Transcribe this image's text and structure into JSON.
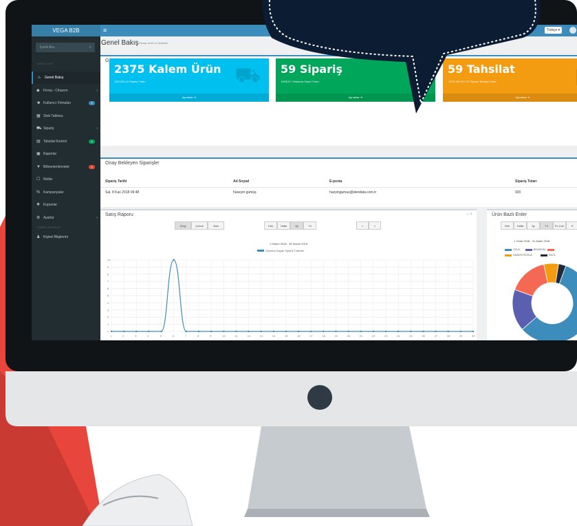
{
  "app": {
    "brand": "VEGA B2B",
    "menu_icon": "hamburger-icon",
    "language": "Türkçe ▾"
  },
  "sidebar": {
    "search_placeholder": "İçerik Ara...",
    "section_label": "MENÜLER",
    "items": [
      {
        "icon": "home-icon",
        "label": "Genel Bakış",
        "active": true
      },
      {
        "icon": "tags-icon",
        "label": "Firma - Cihazım",
        "chevron": true
      },
      {
        "icon": "users-icon",
        "label": "Kullanıcı Firmaları",
        "badge": "1",
        "badge_color": "#3c8dbc"
      },
      {
        "icon": "table-icon",
        "label": "Stok Tablosu"
      },
      {
        "icon": "cart-icon",
        "label": "Sipariş",
        "chevron": true
      },
      {
        "icon": "money-icon",
        "label": "Tahsilat Kontrol",
        "badge": "1",
        "badge_color": "#00a65a"
      },
      {
        "icon": "report-icon",
        "label": "Raporlar"
      },
      {
        "icon": "filter-icon",
        "label": "Bilinenlerlimneler",
        "badge": "1",
        "badge_color": "#dd4b39"
      },
      {
        "icon": "note-icon",
        "label": "Notlar"
      },
      {
        "icon": "percent-icon",
        "label": "Kampanyalar"
      },
      {
        "icon": "coupon-icon",
        "label": "Kuponlar"
      },
      {
        "icon": "settings-icon",
        "label": "Ayarlar",
        "chevron": true
      }
    ],
    "section2_label": "KİŞİSEL BİLGİLER",
    "items2": [
      {
        "icon": "user-icon",
        "label": "Kişisel Bilgilerim"
      }
    ]
  },
  "header": {
    "title": "Genel Bakış",
    "subtitle": "Hesap özeti ve istatistik"
  },
  "summary": {
    "title": "Genel",
    "tiles": [
      {
        "big": "2375 Kalem Ürün",
        "small": "625.002,24 Sipariş Tutarı",
        "foot": "Ayrıntılar ➜",
        "color": "#00c0ef",
        "glyph": "cart-icon"
      },
      {
        "big": "59 Sipariş",
        "small": "6308,07 Ortalama Sepet Tutarı",
        "foot": "Ayrıntılar ➜",
        "color": "#00a65a",
        "glyph": "bar-chart-icon"
      },
      {
        "big": "59 Tahsilat",
        "small": "4130.398,007,24 Toplam Tahsilat Tutarı",
        "foot": "Ayrıntılar ➜",
        "color": "#f39c12",
        "glyph": "money-icon"
      }
    ]
  },
  "pending": {
    "title": "Onay Bekleyen Siparişler",
    "columns": [
      "Sipariş Tarihi",
      "Ad Soyad",
      "E-posta",
      "Sipariş Tutarı"
    ],
    "rows": [
      [
        "Sal, 8 Kas 2018 09:48",
        "hüseyin gümüş",
        "hueyingumus@deridata.com.tr",
        "920"
      ]
    ]
  },
  "sales": {
    "title": "Satış Raporu",
    "group1": [
      "Çizgi",
      "Çubuk",
      "Alan"
    ],
    "group1_active": 0,
    "group2": [
      "Gün",
      "Hafta",
      "Ay",
      "Yıl"
    ],
    "group2_active": 2,
    "group3": [
      "«",
      "»"
    ],
    "window_controls": "–  ×",
    "range": "1 Kasım 2018 - 30 Kasım 2018",
    "legend": "Zamana Dayalı Sipariş Tutarları"
  },
  "products": {
    "title": "Ürün Bazlı Enler",
    "buttons": [
      "Gün",
      "Hafta",
      "Ay",
      "Yıl",
      "En Çok",
      "E"
    ],
    "active": 3,
    "range": "1 Ocak 2018 - 31 Aralık 2018",
    "legend": [
      "OOLA",
      "BİSANCİM",
      "",
      "HAVAYİLTROSLA",
      "RAYİL"
    ]
  },
  "chart_data": [
    {
      "type": "line",
      "title": "1 Kasım 2018 - 30 Kasım 2018",
      "series": [
        {
          "name": "Zamana Dayalı Sipariş Tutarları",
          "color": "#3c8dbc",
          "values": [
            0,
            0,
            0,
            0,
            0,
            10,
            0,
            0,
            0,
            0,
            0,
            0,
            0,
            0,
            0,
            0,
            0,
            0,
            0,
            0,
            0,
            0,
            0,
            0,
            0,
            0,
            0,
            0,
            0,
            0
          ]
        }
      ],
      "x": [
        1,
        2,
        3,
        4,
        5,
        6,
        7,
        8,
        9,
        10,
        11,
        12,
        13,
        14,
        15,
        16,
        17,
        18,
        19,
        20,
        21,
        22,
        23,
        24,
        25,
        26,
        27,
        28,
        29,
        30
      ],
      "yticks": [
        0,
        1,
        2,
        3,
        4,
        5,
        6,
        7,
        8,
        9,
        10
      ],
      "ylim": [
        0,
        10
      ],
      "grid": true
    },
    {
      "type": "pie",
      "title": "1 Ocak 2018 - 31 Aralık 2018",
      "categories": [
        "OOLA",
        "BİSANCİM",
        "",
        "HAVAYİLTROSLA",
        "RAYİL"
      ],
      "values": [
        58,
        17,
        16,
        6,
        3
      ],
      "colors": [
        "#3c8dbc",
        "#5a5fb0",
        "#f56954",
        "#f39c12",
        "#1f2a3c"
      ]
    }
  ]
}
